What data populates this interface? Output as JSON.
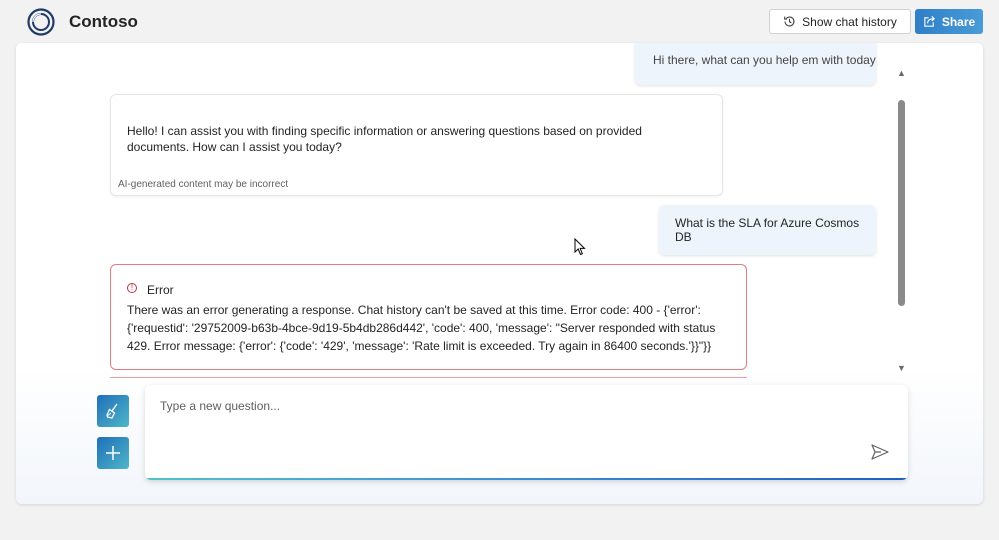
{
  "header": {
    "title": "Contoso",
    "history_button": "Show chat history",
    "share_button": "Share"
  },
  "chat": {
    "previous_question": "Hi there, what can you help em with today",
    "answer": {
      "text": "Hello! I can assist you with finding specific information or answering questions based on provided documents. How can I assist you today?",
      "disclaimer": "AI-generated content may be incorrect"
    },
    "question": "What is the SLA for Azure Cosmos DB",
    "error": {
      "title": "Error",
      "message": "There was an error generating a response. Chat history can't be saved at this time. Error code: 400 - {'error': {'requestid': '29752009-b63b-4bce-9d19-5b4db286d442', 'code': 400, 'message': \"Server responded with status 429. Error message: {'error': {'code': '429', 'message': 'Rate limit is exceeded. Try again in 86400 seconds.'}}\"}}"
    }
  },
  "input": {
    "placeholder": "Type a new question..."
  },
  "icons": {
    "logo": "contoso-logo-icon",
    "history": "history-icon",
    "share": "share-icon",
    "error": "error-circle-icon",
    "clear": "broom-icon",
    "new_chat": "plus-icon",
    "send": "send-icon"
  },
  "colors": {
    "accent": "#2f7fc7",
    "error_border": "#e37d80",
    "user_bubble": "#eef4fb"
  }
}
